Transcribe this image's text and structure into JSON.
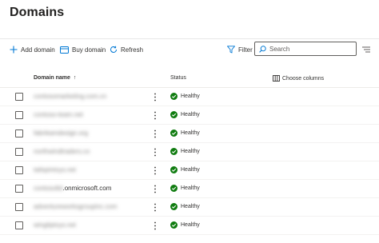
{
  "page": {
    "title": "Domains"
  },
  "toolbar": {
    "add_label": "Add domain",
    "buy_label": "Buy domain",
    "refresh_label": "Refresh",
    "filter_label": "Filter",
    "search_placeholder": "Search"
  },
  "table": {
    "columns": {
      "name": "Domain name",
      "status": "Status",
      "choose_columns": "Choose columns"
    },
    "sort_indicator": "↑",
    "rows": [
      {
        "domain": "contosomarketing.com.cn",
        "domain_visible": "",
        "blurred": true,
        "status": "Healthy"
      },
      {
        "domain": "contoso-team.net",
        "domain_visible": "",
        "blurred": true,
        "status": "Healthy"
      },
      {
        "domain": "fabrikamdesign.org",
        "domain_visible": "",
        "blurred": true,
        "status": "Healthy"
      },
      {
        "domain": "northwindtraders.co",
        "domain_visible": "",
        "blurred": true,
        "status": "Healthy"
      },
      {
        "domain": "tailspintoys.net",
        "domain_visible": "",
        "blurred": true,
        "status": "Healthy"
      },
      {
        "domain": "contosoltd",
        "domain_visible": ".onmicrosoft.com",
        "blurred": true,
        "status": "Healthy"
      },
      {
        "domain": "adventureworksgroupinc.com",
        "domain_visible": "",
        "blurred": true,
        "status": "Healthy"
      },
      {
        "domain": "wingtiptoys.net",
        "domain_visible": "",
        "blurred": true,
        "status": "Healthy"
      }
    ]
  },
  "colors": {
    "accent": "#0078d4",
    "healthy": "#107c10",
    "text": "#323130"
  }
}
